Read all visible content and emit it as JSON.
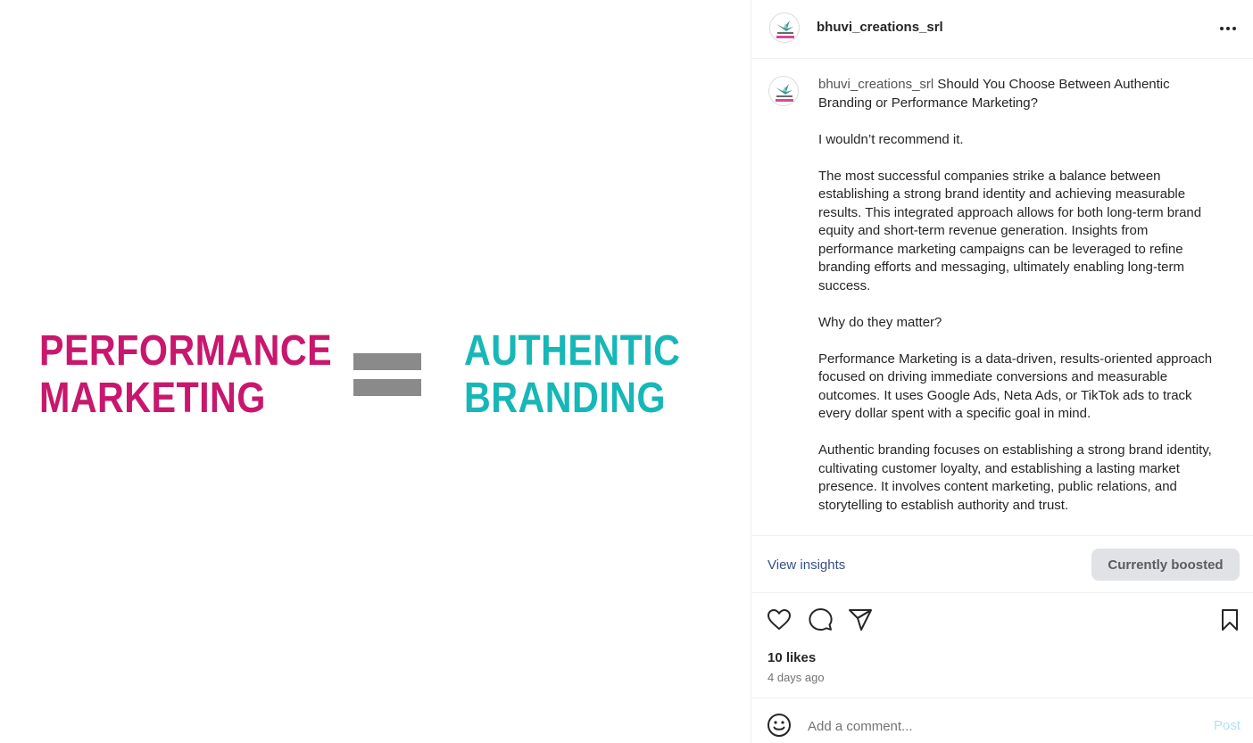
{
  "media": {
    "left_line1": "PERFORMANCE",
    "left_line2": "MARKETING",
    "right_line1": "AUTHENTIC",
    "right_line2": "BRANDING",
    "left_color": "#c8176d",
    "right_color": "#17b7b7",
    "equals_color": "#8a8a8a"
  },
  "header": {
    "username": "bhuvi_creations_srl",
    "more_icon": "more-horizontal-icon"
  },
  "caption": {
    "username": "bhuvi_creations_srl",
    "first_line": "Should You Choose Between Authentic Branding or Performance Marketing?",
    "paragraphs": [
      "I wouldn’t recommend it.",
      "The most successful companies strike a balance between establishing a strong brand identity and achieving measurable results. This integrated approach allows for both long-term brand equity and short-term revenue generation. Insights from performance marketing campaigns can be leveraged to refine branding efforts and messaging, ultimately enabling long-term success.",
      "Why do they matter?",
      "Performance Marketing is a data-driven, results-oriented approach focused on driving immediate conversions and measurable outcomes. It uses Google Ads, Neta Ads, or TikTok ads to track every dollar spent with a specific goal in mind.",
      "Authentic branding focuses on establishing a strong brand identity, cultivating customer loyalty, and establishing a lasting market presence. It involves content marketing, public relations, and storytelling to establish authority and trust."
    ]
  },
  "insights": {
    "view_label": "View insights",
    "boost_label": "Currently boosted"
  },
  "actions": {
    "like_icon": "heart-icon",
    "comment_icon": "comment-bubble-icon",
    "share_icon": "paper-plane-icon",
    "save_icon": "bookmark-icon"
  },
  "stats": {
    "likes": "10 likes",
    "time_ago": "4 days ago"
  },
  "comment": {
    "placeholder": "Add a comment...",
    "post_label": "Post",
    "emoji_icon": "emoji-icon"
  }
}
